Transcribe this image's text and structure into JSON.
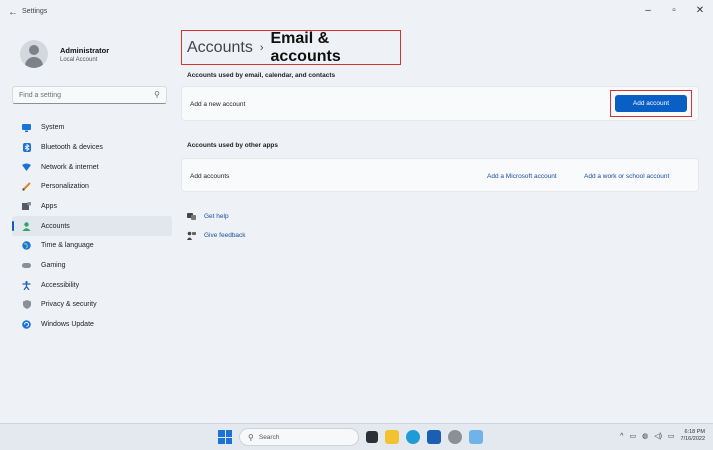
{
  "window": {
    "back": "←",
    "title": "Settings",
    "minimize": "–",
    "maximize": "▫",
    "close": "✕"
  },
  "profile": {
    "name": "Administrator",
    "account_type": "Local Account"
  },
  "search": {
    "placeholder": "Find a setting"
  },
  "nav": {
    "items": [
      {
        "label": "System",
        "icon": "monitor-icon",
        "color": "#1a73d9"
      },
      {
        "label": "Bluetooth & devices",
        "icon": "bluetooth-icon",
        "color": "#1a73d9"
      },
      {
        "label": "Network & internet",
        "icon": "wifi-icon",
        "color": "#1a73d9"
      },
      {
        "label": "Personalization",
        "icon": "brush-icon",
        "color": "#d68a1a"
      },
      {
        "label": "Apps",
        "icon": "apps-icon",
        "color": "#555b66"
      },
      {
        "label": "Accounts",
        "icon": "person-icon",
        "color": "#2aa862"
      },
      {
        "label": "Time & language",
        "icon": "globe-icon",
        "color": "#1a73d9"
      },
      {
        "label": "Gaming",
        "icon": "gamepad-icon",
        "color": "#6b7380"
      },
      {
        "label": "Accessibility",
        "icon": "accessibility-icon",
        "color": "#1a5fb4"
      },
      {
        "label": "Privacy & security",
        "icon": "shield-icon",
        "color": "#6b7380"
      },
      {
        "label": "Windows Update",
        "icon": "update-icon",
        "color": "#1a73d9"
      }
    ],
    "active": "Accounts"
  },
  "breadcrumb": {
    "root": "Accounts",
    "separator": "›",
    "page": "Email & accounts"
  },
  "section1": {
    "label": "Accounts used by email, calendar, and contacts",
    "row_text": "Add a new account",
    "button": "Add account"
  },
  "section2": {
    "label": "Accounts used by other apps",
    "row_text": "Add accounts",
    "link_microsoft": "Add a Microsoft account",
    "link_work": "Add a work or school account"
  },
  "help": {
    "get_help": "Get help",
    "give_feedback": "Give feedback"
  },
  "taskbar": {
    "search": "Search",
    "time": "6:18 PM",
    "date": "7/16/2022"
  },
  "colors": {
    "accent": "#0a5fc4",
    "highlight_box": "#d9342b"
  }
}
